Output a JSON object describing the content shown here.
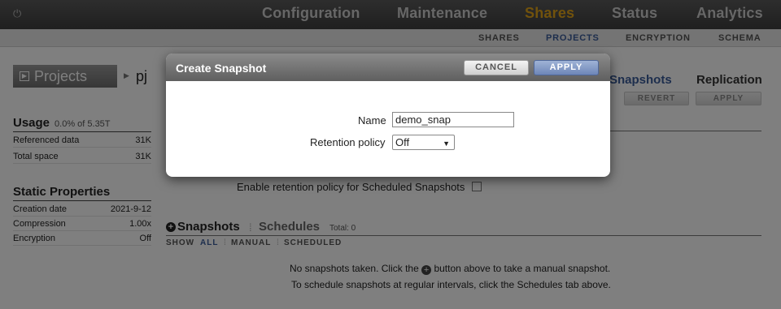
{
  "nav": {
    "tabs": [
      "Configuration",
      "Maintenance",
      "Shares",
      "Status",
      "Analytics"
    ],
    "active": "Shares",
    "power_icon": "power-icon"
  },
  "subnav": {
    "tabs": [
      "SHARES",
      "PROJECTS",
      "ENCRYPTION",
      "SCHEMA"
    ],
    "active": "PROJECTS"
  },
  "header": {
    "projects_label": "Projects",
    "project_name": "pj"
  },
  "right_tabs": {
    "snapshots": "Snapshots",
    "replication": "Replication",
    "revert": "REVERT",
    "apply": "APPLY"
  },
  "usage": {
    "title": "Usage",
    "summary": "0.0% of 5.35T",
    "rows": [
      {
        "k": "Referenced data",
        "v": "31K"
      },
      {
        "k": "Total space",
        "v": "31K"
      }
    ]
  },
  "static": {
    "title": "Static Properties",
    "rows": [
      {
        "k": "Creation date",
        "v": "2021-9-12"
      },
      {
        "k": "Compression",
        "v": "1.00x"
      },
      {
        "k": "Encryption",
        "v": "Off"
      }
    ]
  },
  "retention": {
    "enable_label": "Enable retention policy for Scheduled Snapshots",
    "checked": false
  },
  "snapshots": {
    "tab_snapshots": "Snapshots",
    "tab_schedules": "Schedules",
    "total": "Total: 0",
    "filter_show": "SHOW",
    "filter_all": "ALL",
    "filter_manual": "MANUAL",
    "filter_scheduled": "SCHEDULED",
    "empty_before": "No snapshots taken. Click the",
    "empty_after": "button above to take a manual snapshot.",
    "empty_line2": "To schedule snapshots at regular intervals, click the Schedules tab above."
  },
  "dialog": {
    "title": "Create Snapshot",
    "cancel": "CANCEL",
    "apply": "APPLY",
    "name_label": "Name",
    "name_value": "demo_snap",
    "retention_label": "Retention policy",
    "retention_value": "Off"
  }
}
